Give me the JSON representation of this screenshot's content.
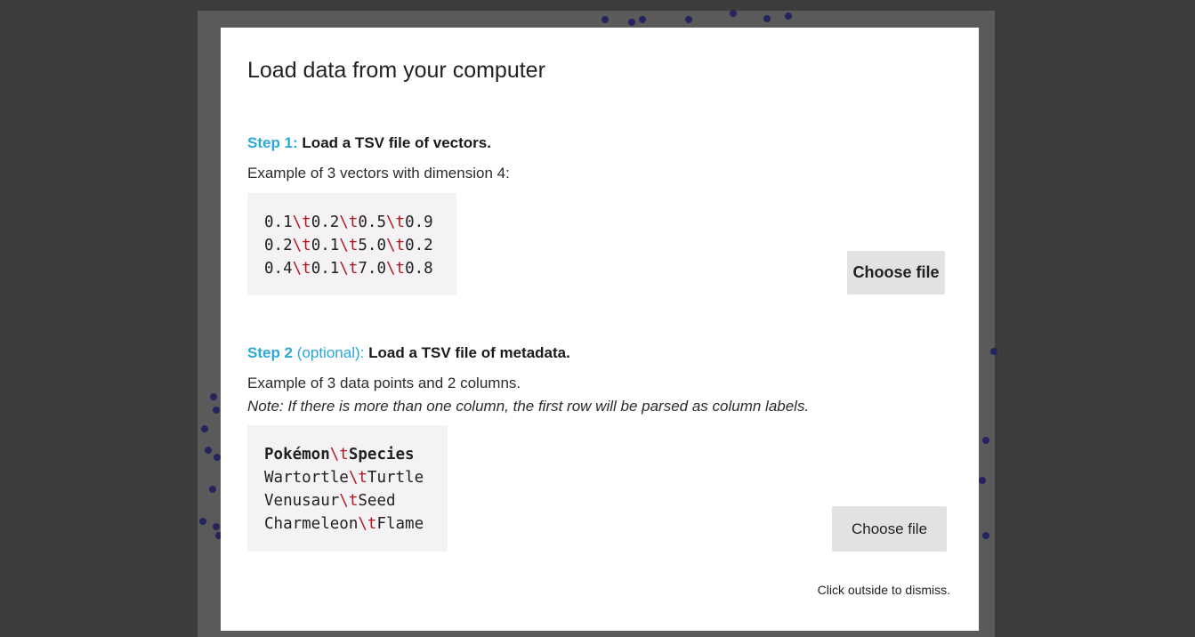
{
  "dialog": {
    "title": "Load data from your computer",
    "dismiss_hint": "Click outside to dismiss."
  },
  "step1": {
    "label": "Step 1:",
    "heading": "Load a TSV file of vectors.",
    "description": "Example of 3 vectors with dimension 4:",
    "tab_escape": "\\t",
    "rows": [
      [
        "0.1",
        "0.2",
        "0.5",
        "0.9"
      ],
      [
        "0.2",
        "0.1",
        "5.0",
        "0.2"
      ],
      [
        "0.4",
        "0.1",
        "7.0",
        "0.8"
      ]
    ],
    "button_label": "Choose file"
  },
  "step2": {
    "label": "Step 2",
    "optional": "(optional):",
    "heading": "Load a TSV file of metadata.",
    "description": "Example of 3 data points and 2 columns.",
    "note": "Note: If there is more than one column, the first row will be parsed as column labels.",
    "tab_escape": "\\t",
    "header_row": [
      "Pokémon",
      "Species"
    ],
    "rows": [
      [
        "Wartortle",
        "Turtle"
      ],
      [
        "Venusaur",
        "Seed"
      ],
      [
        "Charmeleon",
        "Flame"
      ]
    ],
    "button_label": "Choose file"
  },
  "colors": {
    "accent": "#2aa8d8",
    "tab_escape": "#b3191c",
    "scatter_dot": "#26245e",
    "overlay": "#3c3c3c"
  }
}
